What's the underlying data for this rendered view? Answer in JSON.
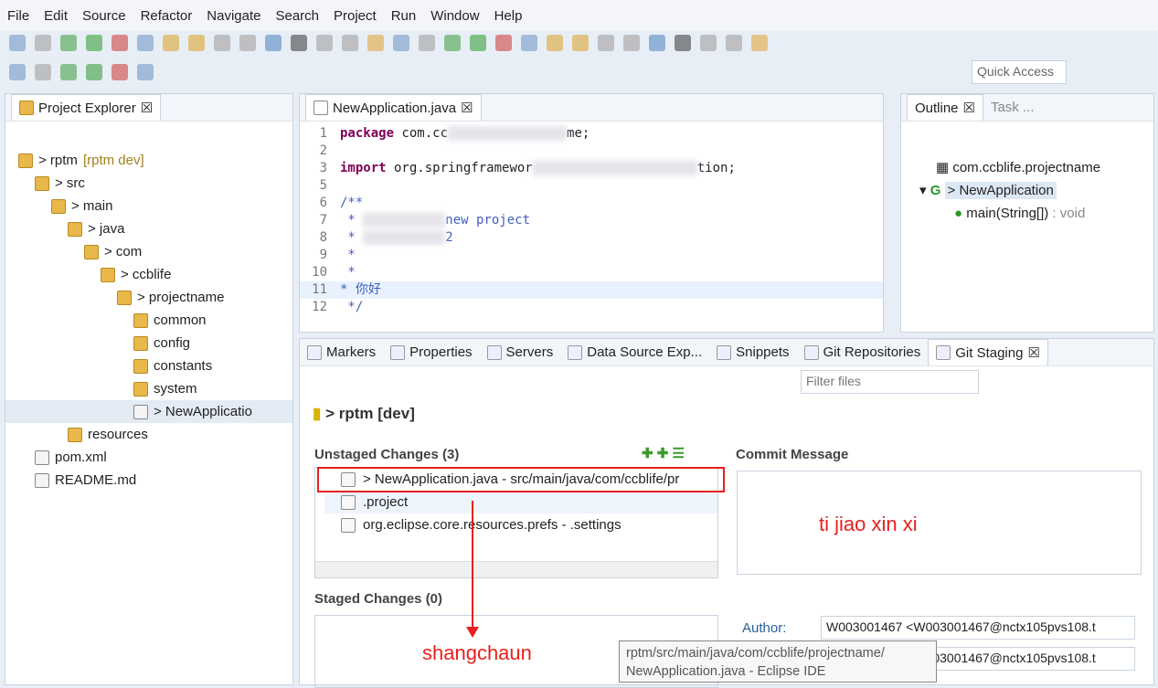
{
  "menu": [
    "File",
    "Edit",
    "Source",
    "Refactor",
    "Navigate",
    "Search",
    "Project",
    "Run",
    "Window",
    "Help"
  ],
  "quick_access": "Quick Access",
  "project_explorer": {
    "title": "Project Explorer",
    "tree": [
      {
        "label": "> rptm",
        "extra": "[rptm dev]",
        "depth": 0
      },
      {
        "label": "> src",
        "depth": 1
      },
      {
        "label": "> main",
        "depth": 2
      },
      {
        "label": "> java",
        "depth": 3
      },
      {
        "label": "> com",
        "depth": 4
      },
      {
        "label": "> ccblife",
        "depth": 5
      },
      {
        "label": "> projectname",
        "depth": 6
      },
      {
        "label": "common",
        "depth": 7
      },
      {
        "label": "config",
        "depth": 7
      },
      {
        "label": "constants",
        "depth": 7
      },
      {
        "label": "system",
        "depth": 7
      },
      {
        "label": "> NewApplicatio",
        "depth": 7
      },
      {
        "label": "resources",
        "depth": 3
      },
      {
        "label": "pom.xml",
        "depth": 1
      },
      {
        "label": "README.md",
        "depth": 1
      }
    ]
  },
  "editor": {
    "tab": "NewApplication.java",
    "lines": [
      {
        "n": "1",
        "a": "package",
        "b": " com.cc",
        "c": "me;"
      },
      {
        "n": "2"
      },
      {
        "n": "3",
        "a": "import",
        "b": " org.springframewor",
        "c": "tion;"
      },
      {
        "n": "5"
      },
      {
        "n": "6",
        "cm": "/**"
      },
      {
        "n": "7",
        "cm": " * ",
        "c": "new project"
      },
      {
        "n": "8",
        "cm": " * ",
        "c": "2"
      },
      {
        "n": "9",
        "cm": " *"
      },
      {
        "n": "10",
        "cm": " *"
      },
      {
        "n": "11",
        "cm": "* 你好"
      },
      {
        "n": "12",
        "cm": " */"
      }
    ]
  },
  "outline": {
    "title": "Outline",
    "tab2": "Task ...",
    "package": "com.ccblife.projectname",
    "class": "> NewApplication",
    "method": "main(String[])",
    "method_type": " : void"
  },
  "bottom_tabs": [
    "Markers",
    "Properties",
    "Servers",
    "Data Source Exp...",
    "Snippets",
    "Git Repositories",
    "Git Staging"
  ],
  "staging": {
    "filter_placeholder": "Filter files",
    "repo": "> rptm [dev]",
    "unstaged_title": "Unstaged Changes (3)",
    "unstaged": [
      "> NewApplication.java - src/main/java/com/ccblife/pr",
      ".project",
      "org.eclipse.core.resources.prefs - .settings"
    ],
    "staged_title": "Staged Changes (0)",
    "commit_title": "Commit Message",
    "author_label": "Author:",
    "author": "W003001467 <W003001467@nctx105pvs108.t",
    "committer": "W003001467 <W003001467@nctx105pvs108.t"
  },
  "tooltip": [
    "rptm/src/main/java/com/ccblife/projectname/",
    "NewApplication.java - Eclipse IDE"
  ],
  "annotations": {
    "commit_note": "ti jiao xin xi",
    "upload_note": "shangchaun",
    "color": "#e8201e"
  }
}
